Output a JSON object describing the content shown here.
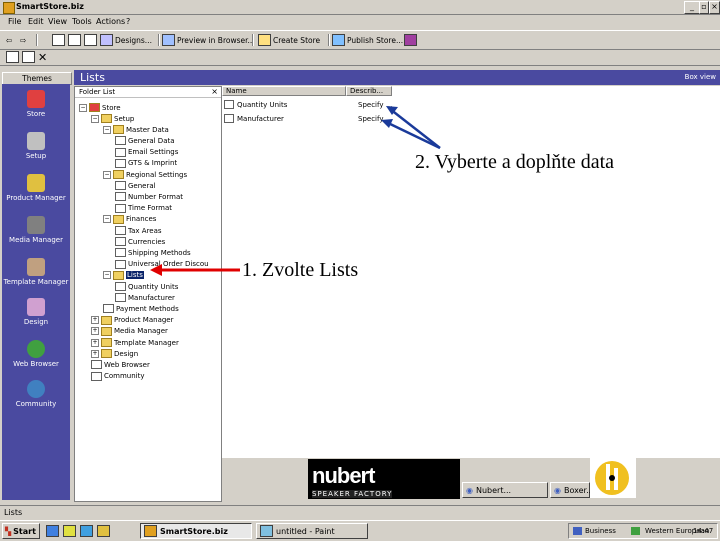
{
  "window": {
    "title": "SmartStore.biz"
  },
  "menu": {
    "items": [
      "File",
      "Edit",
      "View",
      "Tools",
      "Actions",
      "?"
    ]
  },
  "toolbar": {
    "buttons": [
      "Designs...",
      "Preview in Browser...",
      "Create Store",
      "Publish Store..."
    ]
  },
  "themes": {
    "header": "Themes",
    "items": [
      "Store",
      "Setup",
      "Product Manager",
      "Media Manager",
      "Template Manager",
      "Design",
      "Web Browser",
      "Community"
    ]
  },
  "main": {
    "title": "Lists",
    "right_label": "Box view"
  },
  "folder_list": {
    "header": "Folder List",
    "root": "Store",
    "items": [
      {
        "label": "Setup",
        "level": 1,
        "icon": "folder"
      },
      {
        "label": "Master Data",
        "level": 2,
        "icon": "folder"
      },
      {
        "label": "General Data",
        "level": 3,
        "icon": "doc"
      },
      {
        "label": "Email Settings",
        "level": 3,
        "icon": "doc"
      },
      {
        "label": "GTS & Imprint",
        "level": 3,
        "icon": "doc"
      },
      {
        "label": "Regional Settings",
        "level": 2,
        "icon": "folder"
      },
      {
        "label": "General",
        "level": 3,
        "icon": "doc"
      },
      {
        "label": "Number Format",
        "level": 3,
        "icon": "doc"
      },
      {
        "label": "Time Format",
        "level": 3,
        "icon": "doc"
      },
      {
        "label": "Finances",
        "level": 2,
        "icon": "folder"
      },
      {
        "label": "Tax Areas",
        "level": 3,
        "icon": "doc"
      },
      {
        "label": "Currencies",
        "level": 3,
        "icon": "doc"
      },
      {
        "label": "Shipping Methods",
        "level": 3,
        "icon": "doc"
      },
      {
        "label": "Universal Order Discou",
        "level": 3,
        "icon": "doc"
      },
      {
        "label": "Lists",
        "level": 2,
        "icon": "folder",
        "selected": true
      },
      {
        "label": "Quantity Units",
        "level": 3,
        "icon": "doc"
      },
      {
        "label": "Manufacturer",
        "level": 3,
        "icon": "doc"
      },
      {
        "label": "Payment Methods",
        "level": 2,
        "icon": "doc"
      },
      {
        "label": "Product Manager",
        "level": 1,
        "icon": "folder"
      },
      {
        "label": "Media Manager",
        "level": 1,
        "icon": "folder"
      },
      {
        "label": "Template Manager",
        "level": 1,
        "icon": "folder"
      },
      {
        "label": "Design",
        "level": 1,
        "icon": "folder"
      },
      {
        "label": "Web Browser",
        "level": 1,
        "icon": "doc"
      },
      {
        "label": "Community",
        "level": 1,
        "icon": "doc"
      }
    ]
  },
  "content": {
    "columns": [
      "Name",
      "Describ..."
    ],
    "rows": [
      {
        "name": "Quantity Units",
        "desc": "Specify ..."
      },
      {
        "name": "Manufacturer",
        "desc": "Specify ..."
      }
    ]
  },
  "banner": {
    "logo": "nubert",
    "sub": "SPEAKER FACTORY"
  },
  "bottom_tabs": [
    "Nubert...",
    "Boxer..."
  ],
  "status": {
    "text": "Lists"
  },
  "taskbar": {
    "start": "Start",
    "tasks": [
      "SmartStore.biz",
      "untitled - Paint"
    ],
    "tray": [
      "Business",
      "Western European"
    ],
    "clock": "14:47"
  },
  "annotations": {
    "step1": "1. Zvolte Lists",
    "step2": "2. Vyberte a doplňte data"
  },
  "colors": {
    "theme_bg": "#4a4aa0",
    "window_bg": "#d4d0c8",
    "arrow_blue": "#1a3a9a",
    "arrow_red": "#e00000"
  }
}
